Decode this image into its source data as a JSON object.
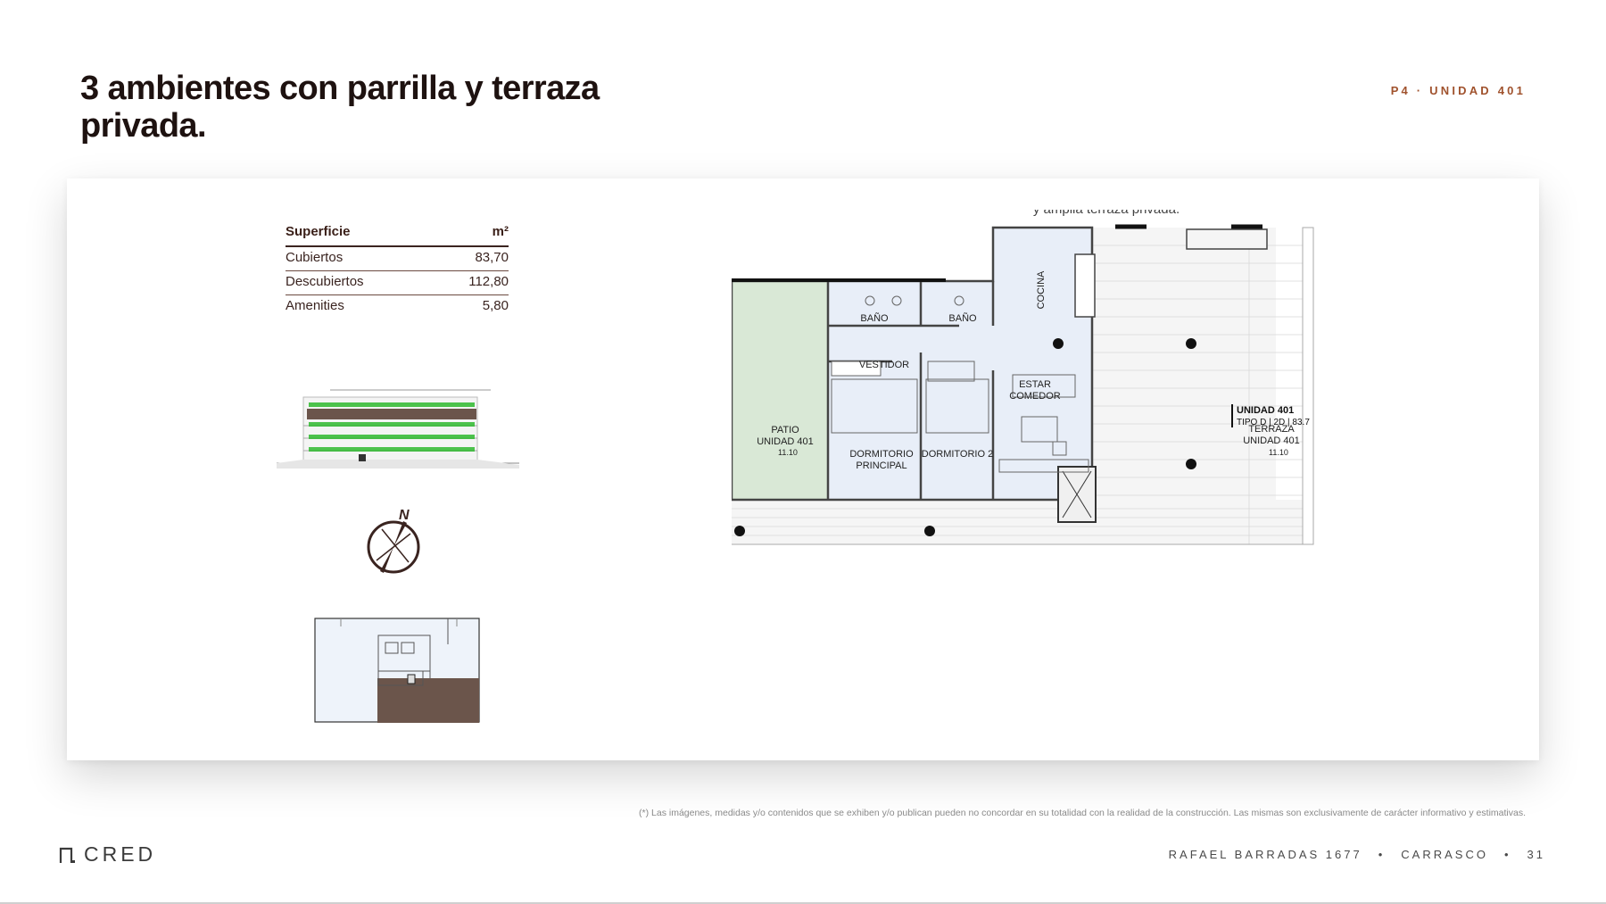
{
  "header": {
    "title": "3 ambientes con parrilla y terraza privada.",
    "tag": "P4 · UNIDAD 401"
  },
  "surface_table": {
    "header": {
      "label": "Superficie",
      "unit": "m²"
    },
    "rows": [
      {
        "label": "Cubiertos",
        "value": "83,70"
      },
      {
        "label": "Descubiertos",
        "value": "112,80"
      },
      {
        "label": "Amenities",
        "value": "5,80"
      }
    ]
  },
  "compass": {
    "label": "N"
  },
  "floor_plan": {
    "cropped_top_text": "y amplia terraza privada.",
    "rooms": {
      "bano1": "BAÑO",
      "bano2": "BAÑO",
      "cocina": "COCINA",
      "vestidor": "VESTIDOR",
      "estar1": "ESTAR",
      "estar2": "COMEDOR",
      "patio1": "PATIO",
      "patio2": "UNIDAD 401",
      "dorm1a": "DORMITORIO",
      "dorm1b": "PRINCIPAL",
      "dorm2": "DORMITORIO 2",
      "unidad": "UNIDAD 401",
      "tipo": "TIPO D | 2D | 83.7",
      "terraza1": "TERRAZA",
      "terraza2": "UNIDAD 401",
      "level1": "11.10",
      "level2": "11.10"
    }
  },
  "disclaimer": "(*) Las imágenes, medidas y/o contenidos que se exhiben y/o publican pueden no concordar en su totalidad con la realidad de la construcción. Las mismas son exclusivamente de carácter informativo y estimativas.",
  "footer": {
    "logo": "CRED",
    "address": "RAFAEL BARRADAS 1677",
    "separator": "•",
    "area": "CARRASCO",
    "page": "31"
  },
  "colors": {
    "title": "#1e1210",
    "accent": "#a0522d",
    "plan_interior": "#e8eef8",
    "plan_patio": "#d9e8d6",
    "keyplan_highlight": "#6b554b"
  }
}
